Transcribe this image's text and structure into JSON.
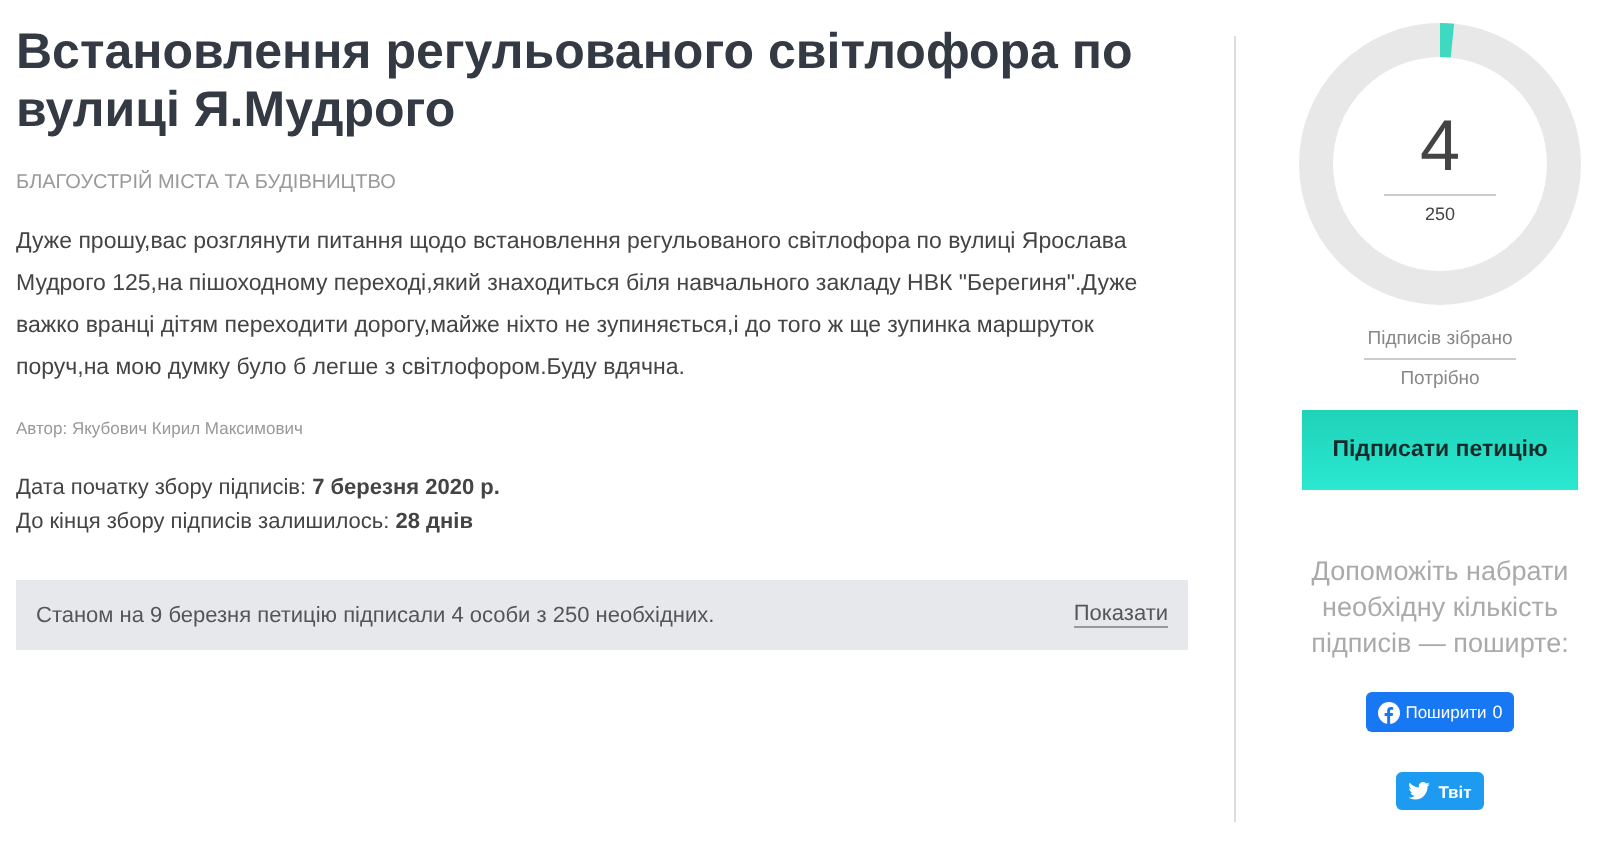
{
  "petition": {
    "title": "Встановлення регульованого світлофора по вулиці Я.Мудрого",
    "category": "БЛАГОУСТРІЙ МІСТА ТА БУДІВНИЦТВО",
    "body": "Дуже прошу,вас розглянути питання щодо встановлення регульованого світлофора по вулиці Ярослава Мудрого 125,на пішоходному переході,який знаходиться біля навчального закладу НВК \"Берегиня\".Дуже важко вранці дітям переходити дорогу,майже ніхто не зупиняється,і до того ж ще зупинка маршруток поруч,на мою думку було б легше з світлофором.Буду вдячна.",
    "author": "Автор: Якубович Кирил Максимович",
    "dates": [
      "Дата початку збору підписів: **7 березня 2020 р.**",
      "До кінця збору підписів залишилось: **28 днів**"
    ]
  },
  "status": {
    "text": "Станом на 9 березня петицію підписали 4 особи з 250 необхідних.",
    "link": "Показати"
  },
  "progress": {
    "level": 0.016,
    "count": "4",
    "target": "250",
    "count_label": "Підписів зібрано",
    "target_label": "Потрібно"
  },
  "sign_button": "Підписати петицію",
  "share": {
    "text": "Допоможіть набрати необхідну кількість підписів — поширте:",
    "facebook": "Поширити",
    "facebook_count": "0",
    "twitter": "Твіт"
  }
}
